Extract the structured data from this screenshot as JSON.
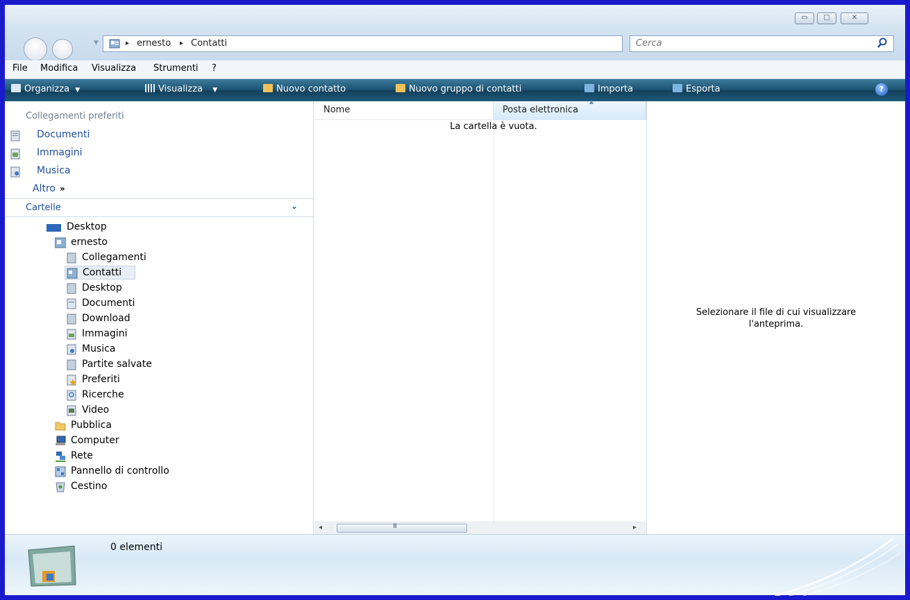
{
  "window": {
    "caption_buttons": {
      "minimize_icon": "minimize-icon",
      "maximize_icon": "maximize-icon",
      "close_icon": "close-icon"
    }
  },
  "address": {
    "crumbs": [
      "ernesto",
      "Contatti"
    ],
    "separator": "▸"
  },
  "search": {
    "placeholder": "Cerca"
  },
  "menu": {
    "items": [
      "File",
      "Modifica",
      "Visualizza",
      "Strumenti",
      "?"
    ]
  },
  "toolbar": {
    "items": [
      "Organizza",
      "Visualizza",
      "Nuovo contatto",
      "Nuovo gruppo di contatti",
      "Importa",
      "Esporta"
    ]
  },
  "nav": {
    "favorites_header": "Collegamenti preferiti",
    "favorites": [
      "Documenti",
      "Immagini",
      "Musica"
    ],
    "more_label": "Altro",
    "folders_header": "Cartelle",
    "tree": [
      "Desktop",
      "ernesto",
      "Collegamenti",
      "Contatti",
      "Desktop",
      "Documenti",
      "Download",
      "Immagini",
      "Musica",
      "Partite salvate",
      "Preferiti",
      "Ricerche",
      "Video",
      "Pubblica",
      "Computer",
      "Rete",
      "Pannello di controllo",
      "Cestino"
    ]
  },
  "content": {
    "columns": [
      "Nome",
      "Posta elettronica"
    ],
    "empty_message": "La cartella è vuota.",
    "scroll_grip": "III"
  },
  "preview": {
    "message_line1": "Selezionare il file di cui visualizzare",
    "message_line2": "l'anteprima."
  },
  "details": {
    "item_count": "0 elementi"
  },
  "colors": {
    "frame": "#1a1acd",
    "toolbar": "#1b506f",
    "link": "#1f4e99",
    "selection": "#e8eef6"
  }
}
